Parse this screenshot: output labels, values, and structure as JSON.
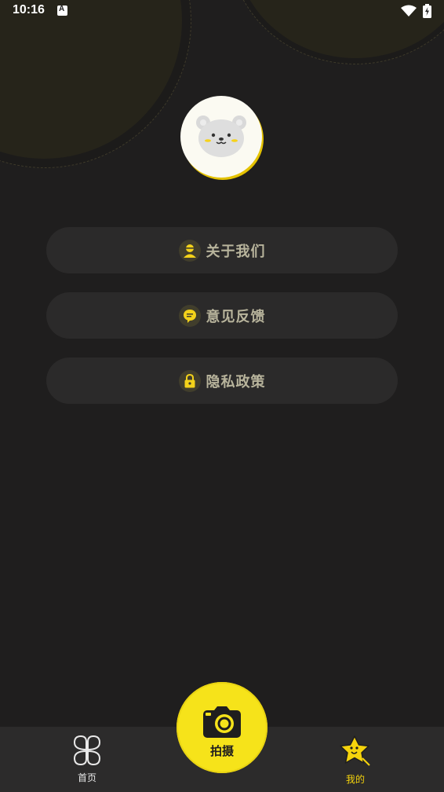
{
  "status_bar": {
    "time": "10:16",
    "notification_letter": "A"
  },
  "colors": {
    "background": "#1f1e1e",
    "accent": "#f6e31a",
    "button_bg": "#2b2a2a",
    "button_text": "#b8b49c"
  },
  "profile": {
    "avatar_icon": "bear-face-icon"
  },
  "menu": {
    "items": [
      {
        "label": "关于我们",
        "icon": "person-icon"
      },
      {
        "label": "意见反馈",
        "icon": "chat-bubble-icon"
      },
      {
        "label": "隐私政策",
        "icon": "lock-icon"
      }
    ]
  },
  "bottom_nav": {
    "home_label": "首页",
    "home_icon": "clover-icon",
    "camera_label": "拍摄",
    "camera_icon": "camera-icon",
    "mine_label": "我的",
    "mine_icon": "star-icon",
    "active": "mine"
  }
}
